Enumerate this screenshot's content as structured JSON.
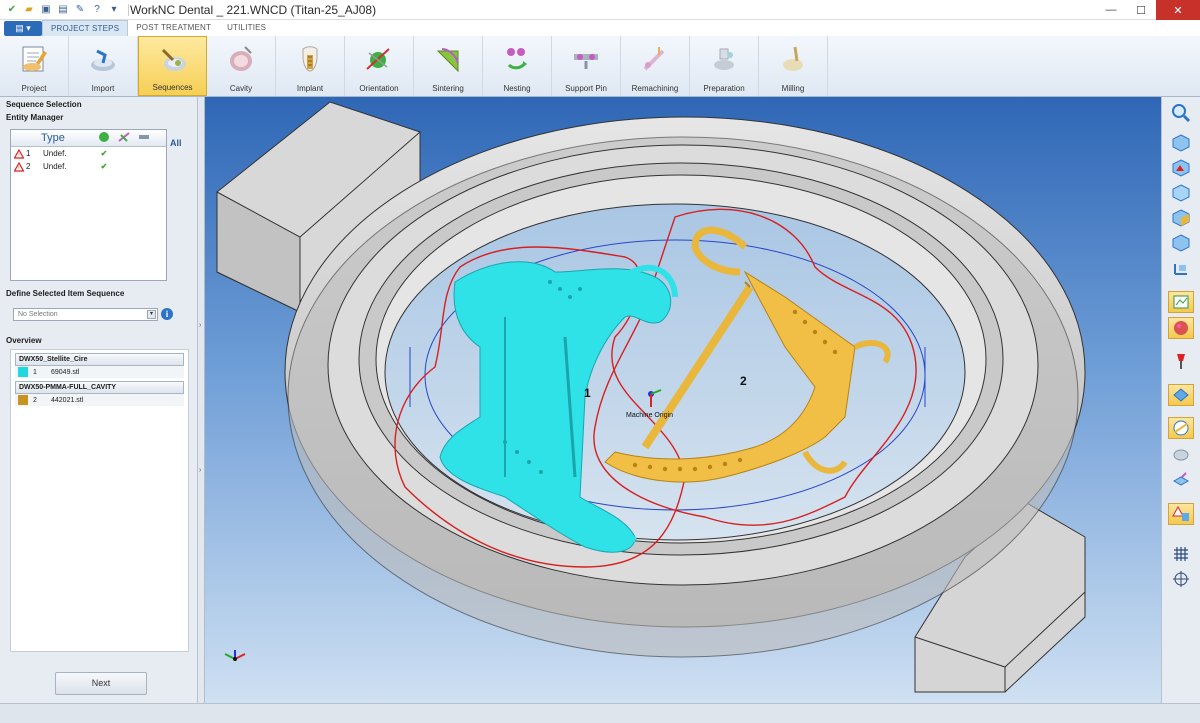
{
  "window": {
    "title": "WorkNC Dental _ 221.WNCD (Titan-25_AJ08)"
  },
  "ribbon_tabs": [
    "PROJECT STEPS",
    "POST TREATMENT",
    "UTILITIES"
  ],
  "ribbon_buttons": [
    {
      "label": "Project",
      "icon": "project-icon"
    },
    {
      "label": "Import",
      "icon": "import-icon"
    },
    {
      "label": "Sequences",
      "icon": "sequences-icon",
      "active": true
    },
    {
      "label": "Cavity",
      "icon": "cavity-icon"
    },
    {
      "label": "Implant",
      "icon": "implant-icon"
    },
    {
      "label": "Orientation",
      "icon": "orientation-icon"
    },
    {
      "label": "Sintering",
      "icon": "sintering-icon"
    },
    {
      "label": "Nesting",
      "icon": "nesting-icon"
    },
    {
      "label": "Support Pin",
      "icon": "support-pin-icon"
    },
    {
      "label": "Remachining",
      "icon": "remachining-icon"
    },
    {
      "label": "Preparation",
      "icon": "preparation-icon"
    },
    {
      "label": "Milling",
      "icon": "milling-icon"
    }
  ],
  "left_panel": {
    "title": "Sequence Selection",
    "entity_manager": {
      "title": "Entity Manager",
      "col_type": "Type",
      "all_label": "All",
      "rows": [
        {
          "num": "1",
          "type": "Undef."
        },
        {
          "num": "2",
          "type": "Undef."
        }
      ]
    },
    "define_sequence": {
      "title": "Define Selected Item Sequence",
      "value": "No Selection"
    },
    "overview": {
      "title": "Overview",
      "groups": [
        {
          "name": "DWX50_Stellite_Cire",
          "item_num": "1",
          "file": "69049.stl",
          "color": "#22d8e0"
        },
        {
          "name": "DWX50-PMMA-FULL_CAVITY",
          "item_num": "2",
          "file": "442021.stl",
          "color": "#c8931f"
        }
      ]
    },
    "next_label": "Next"
  },
  "viewport": {
    "origin_label": "Machine Origin",
    "part_labels": [
      "1",
      "2"
    ]
  },
  "colors": {
    "accent": "#2c6bb8",
    "cyan_part": "#22d8e0",
    "gold_part": "#e9b73c",
    "active_button": "#f6cf55"
  }
}
